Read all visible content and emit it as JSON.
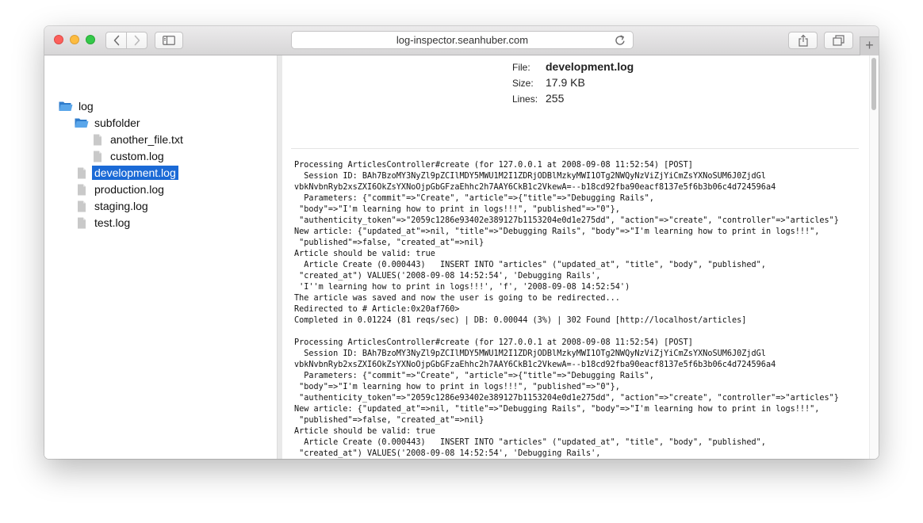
{
  "browser": {
    "url": "log-inspector.seanhuber.com",
    "icons": {
      "back": "chevron-left-icon",
      "forward": "chevron-right-icon",
      "sidebar": "sidebar-icon",
      "reload": "reload-icon",
      "share": "share-icon",
      "tabs": "tabs-icon",
      "new_tab": "plus-icon"
    },
    "new_tab_label": "+"
  },
  "sidebar": {
    "tree": [
      {
        "label": "log",
        "icon": "folder-open-icon",
        "level": 0
      },
      {
        "label": "subfolder",
        "icon": "folder-open-icon",
        "level": 1
      },
      {
        "label": "another_file.txt",
        "icon": "file-icon",
        "level": 2
      },
      {
        "label": "custom.log",
        "icon": "file-icon",
        "level": 2
      },
      {
        "label": "development.log",
        "icon": "file-icon",
        "level": 1,
        "selected": true
      },
      {
        "label": "production.log",
        "icon": "file-icon",
        "level": 1
      },
      {
        "label": "staging.log",
        "icon": "file-icon",
        "level": 1
      },
      {
        "label": "test.log",
        "icon": "file-icon",
        "level": 1
      }
    ],
    "selection_color": "#1b6ad6",
    "folder_color": "#3d8fd9"
  },
  "file_info": {
    "file_label": "File:",
    "file_value": "development.log",
    "size_label": "Size:",
    "size_value": "17.9 KB",
    "lines_label": "Lines:",
    "lines_value": "255"
  },
  "log_content": "Processing ArticlesController#create (for 127.0.0.1 at 2008-09-08 11:52:54) [POST]\n  Session ID: BAh7BzoMY3NyZl9pZCIlMDY5MWU1M2I1ZDRjODBlMzkyMWI1OTg2NWQyNzViZjYiCmZsYXNoSUM6J0ZjdGl\nvbkNvbnRyb2xsZXI6OkZsYXNoOjpGbGFzaEhhc2h7AAY6CkB1c2VkewA=--b18cd92fba90eacf8137e5f6b3b06c4d724596a4\n  Parameters: {\"commit\"=>\"Create\", \"article\"=>{\"title\"=>\"Debugging Rails\",\n \"body\"=>\"I'm learning how to print in logs!!!\", \"published\"=>\"0\"},\n \"authenticity_token\"=>\"2059c1286e93402e389127b1153204e0d1e275dd\", \"action\"=>\"create\", \"controller\"=>\"articles\"}\nNew article: {\"updated_at\"=>nil, \"title\"=>\"Debugging Rails\", \"body\"=>\"I'm learning how to print in logs!!!\",\n \"published\"=>false, \"created_at\"=>nil}\nArticle should be valid: true\n  Article Create (0.000443)   INSERT INTO \"articles\" (\"updated_at\", \"title\", \"body\", \"published\",\n \"created_at\") VALUES('2008-09-08 14:52:54', 'Debugging Rails',\n 'I''m learning how to print in logs!!!', 'f', '2008-09-08 14:52:54')\nThe article was saved and now the user is going to be redirected...\nRedirected to # Article:0x20af760>\nCompleted in 0.01224 (81 reqs/sec) | DB: 0.00044 (3%) | 302 Found [http://localhost/articles]\n\nProcessing ArticlesController#create (for 127.0.0.1 at 2008-09-08 11:52:54) [POST]\n  Session ID: BAh7BzoMY3NyZl9pZCIlMDY5MWU1M2I1ZDRjODBlMzkyMWI1OTg2NWQyNzViZjYiCmZsYXNoSUM6J0ZjdGl\nvbkNvbnRyb2xsZXI6OkZsYXNoOjpGbGFzaEhhc2h7AAY6CkB1c2VkewA=--b18cd92fba90eacf8137e5f6b3b06c4d724596a4\n  Parameters: {\"commit\"=>\"Create\", \"article\"=>{\"title\"=>\"Debugging Rails\",\n \"body\"=>\"I'm learning how to print in logs!!!\", \"published\"=>\"0\"},\n \"authenticity_token\"=>\"2059c1286e93402e389127b1153204e0d1e275dd\", \"action\"=>\"create\", \"controller\"=>\"articles\"}\nNew article: {\"updated_at\"=>nil, \"title\"=>\"Debugging Rails\", \"body\"=>\"I'm learning how to print in logs!!!\",\n \"published\"=>false, \"created_at\"=>nil}\nArticle should be valid: true\n  Article Create (0.000443)   INSERT INTO \"articles\" (\"updated_at\", \"title\", \"body\", \"published\",\n \"created_at\") VALUES('2008-09-08 14:52:54', 'Debugging Rails',\n 'I''m learning how to print in logs!!!', 'f', '2008-09-08 14:52:54')\nThe article was saved and now the user is going to be redirected...\nRedirected to # Article:0x20af760>"
}
